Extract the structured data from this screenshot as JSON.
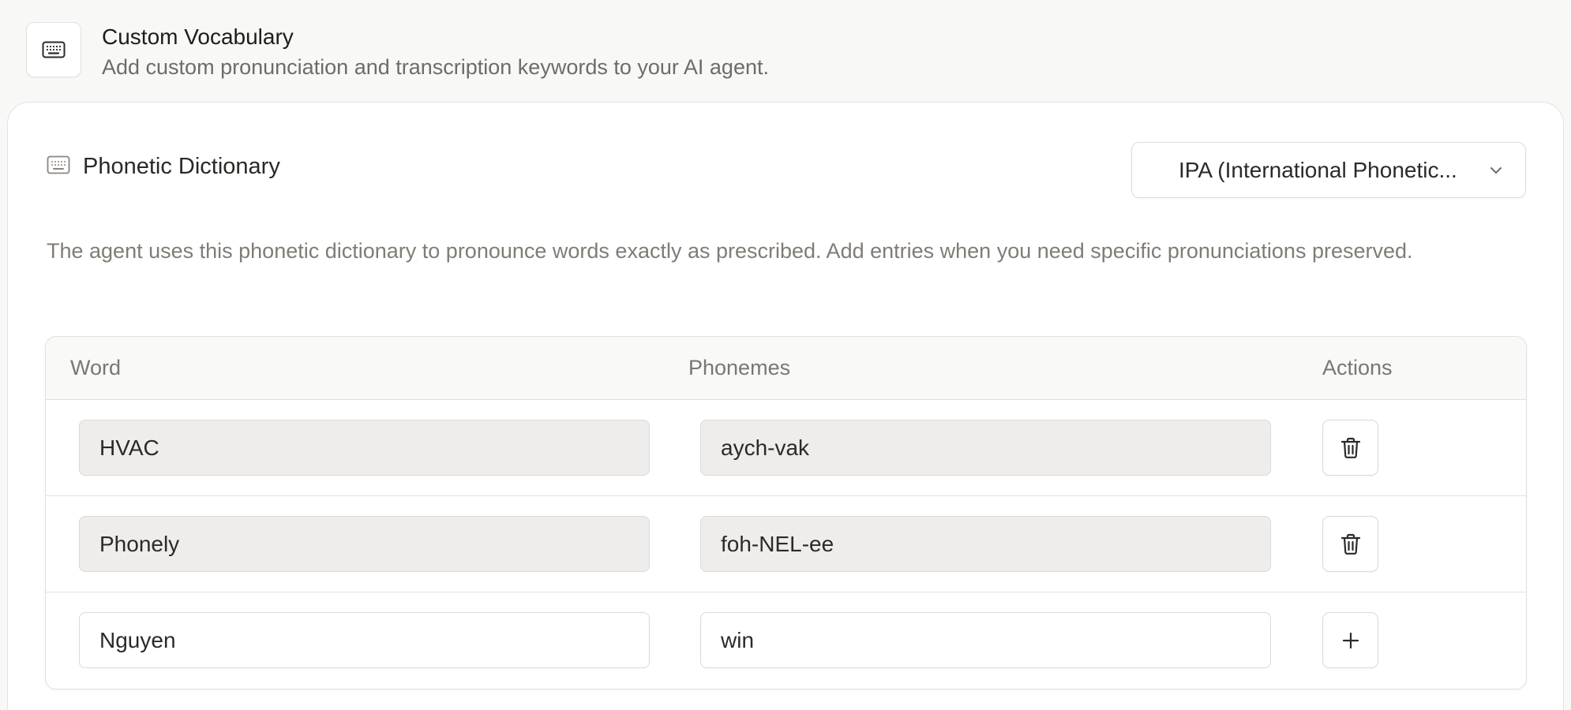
{
  "header": {
    "icon": "keyboard-icon",
    "title": "Custom Vocabulary",
    "subtitle": "Add custom pronunciation and transcription keywords to your AI agent."
  },
  "dictionary": {
    "icon": "keyboard-icon",
    "title": "Phonetic Dictionary",
    "format_select": {
      "value": "IPA (International Phonetic...",
      "icon": "chevron-down-icon"
    },
    "description": "The agent uses this phonetic dictionary to pronounce words exactly as prescribed. Add entries when you need specific pronunciations preserved.",
    "table": {
      "columns": [
        "Word",
        "Phonemes",
        "Actions"
      ],
      "rows": [
        {
          "word": "HVAC",
          "phonemes": "aych-vak",
          "action": "delete",
          "action_icon": "trash-icon"
        },
        {
          "word": "Phonely",
          "phonemes": "foh-NEL-ee",
          "action": "delete",
          "action_icon": "trash-icon"
        }
      ],
      "new_entry": {
        "word": "Nguyen",
        "phonemes": "win",
        "action": "add",
        "action_icon": "plus-icon"
      }
    }
  },
  "colors": {
    "page_bg": "#f8f8f7",
    "card_bg": "#ffffff",
    "border": "#e2e1dd",
    "readonly_field_bg": "#eeedeb",
    "muted_text": "#807c75",
    "header_text": "#7b776f"
  }
}
